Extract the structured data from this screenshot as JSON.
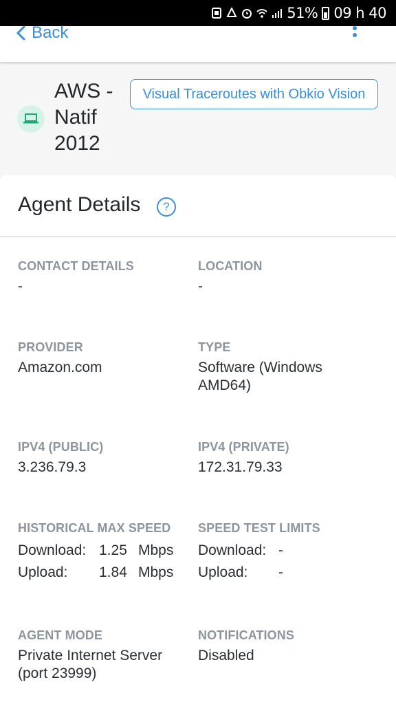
{
  "status_bar": {
    "battery": "51%",
    "time": "09 h 40"
  },
  "app_bar": {
    "back_label": "Back"
  },
  "agent": {
    "name": "AWS - Natif 2012",
    "traceroute_button": "Visual Traceroutes with Obkio Vision"
  },
  "details": {
    "title": "Agent Details",
    "help_symbol": "?",
    "contact": {
      "label": "CONTACT DETAILS",
      "value": "-"
    },
    "location": {
      "label": "LOCATION",
      "value": "-"
    },
    "provider": {
      "label": "PROVIDER",
      "value": "Amazon.com"
    },
    "type": {
      "label": "TYPE",
      "value": "Software (Windows AMD64)"
    },
    "ipv4_public": {
      "label": "IPV4 (PUBLIC)",
      "value": "3.236.79.3"
    },
    "ipv4_private": {
      "label": "IPV4 (PRIVATE)",
      "value": "172.31.79.33"
    },
    "historical_speed": {
      "label": "HISTORICAL MAX SPEED",
      "download_label": "Download:",
      "download_value": "1.25",
      "download_unit": "Mbps",
      "upload_label": "Upload:",
      "upload_value": "1.84",
      "upload_unit": "Mbps"
    },
    "speed_limits": {
      "label": "SPEED TEST LIMITS",
      "download_label": "Download:",
      "download_value": "-",
      "upload_label": "Upload:",
      "upload_value": "-"
    },
    "agent_mode": {
      "label": "AGENT MODE",
      "value": "Private Internet Server (port 23999)"
    },
    "notifications": {
      "label": "NOTIFICATIONS",
      "value": "Disabled"
    }
  },
  "colors": {
    "accent": "#3a8fd6",
    "label_gray": "#8c959d",
    "agent_icon_bg": "#d6f3e8",
    "agent_icon_fg": "#1aa877"
  }
}
